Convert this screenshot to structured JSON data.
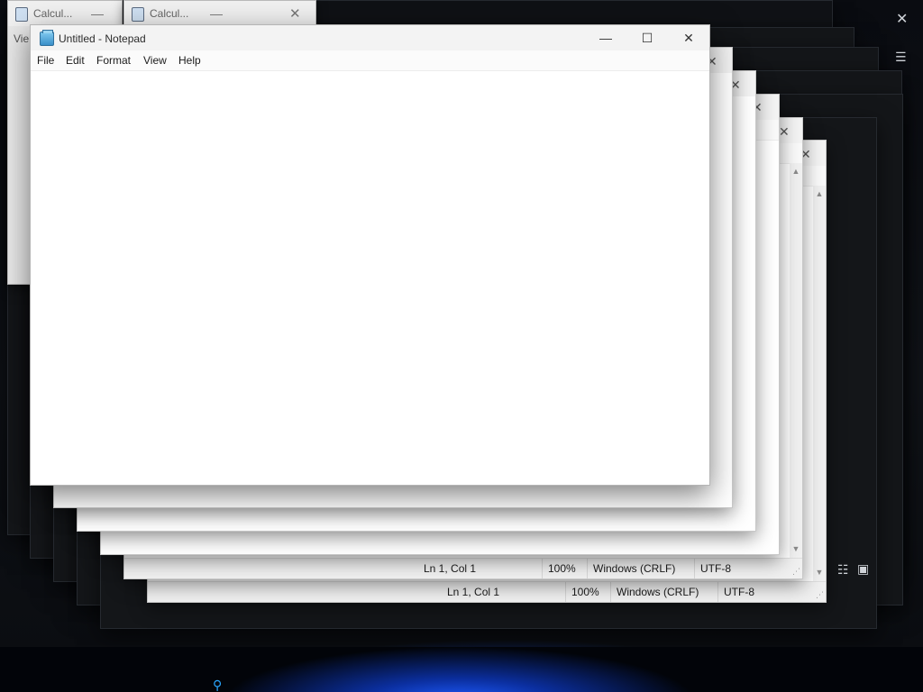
{
  "calculators": [
    {
      "title": "Calcul...",
      "minimize_glyph": "—",
      "close_glyph": "✕"
    },
    {
      "title": "Calcul...",
      "minimize_glyph": "—",
      "close_glyph": "✕"
    }
  ],
  "calc_partial_menu": "Vie",
  "front_window": {
    "title": "Untitled - Notepad",
    "app_icon": "notepad-icon",
    "minimize_glyph": "—",
    "maximize_glyph": "☐",
    "close_glyph": "✕",
    "menu": [
      "File",
      "Edit",
      "Format",
      "View",
      "Help"
    ],
    "editor_text": ""
  },
  "back_window_controls": {
    "maximize_glyph": "☐",
    "close_glyph": "✕"
  },
  "status_bars": [
    {
      "position": "Ln 1, Col 1",
      "zoom": "100%",
      "line_endings": "Windows (CRLF)",
      "encoding": "UTF-8"
    },
    {
      "position": "Ln 1, Col 1",
      "zoom": "100%",
      "line_endings": "Windows (CRLF)",
      "encoding": "UTF-8"
    }
  ],
  "scroll_arrows": {
    "up": "▲",
    "down": "▼"
  },
  "desktop_controls": {
    "close_glyph": "✕",
    "menu_glyph": "☰",
    "list_view_glyph": "☷",
    "tile_view_glyph": "▣"
  },
  "taskbar_icon": "search-pin-icon"
}
